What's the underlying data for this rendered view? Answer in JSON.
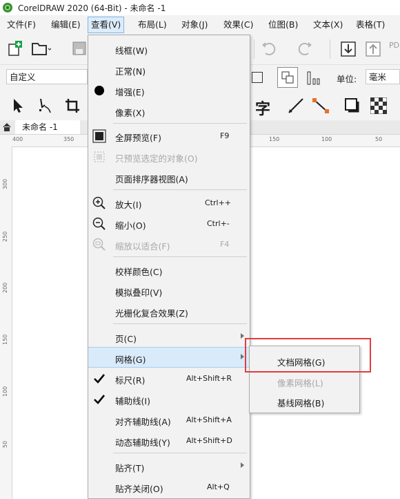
{
  "window": {
    "title": "CorelDRAW 2020 (64-Bit) - 未命名 -1"
  },
  "menubar": {
    "items": [
      {
        "label": "文件(F)"
      },
      {
        "label": "编辑(E)"
      },
      {
        "label": "查看(V)"
      },
      {
        "label": "布局(L)"
      },
      {
        "label": "对象(J)"
      },
      {
        "label": "效果(C)"
      },
      {
        "label": "位图(B)"
      },
      {
        "label": "文本(X)"
      },
      {
        "label": "表格(T)"
      }
    ]
  },
  "toolbar2": {
    "preset": "自定义",
    "units_label": "单位:",
    "units_value": "毫米"
  },
  "toolbar1": {
    "pdf_label": "PD"
  },
  "toolbar3": {
    "text_tool_glyph": "字"
  },
  "document": {
    "tab_label": "未命名 -1"
  },
  "ruler": {
    "h_labels": [
      "400",
      "350",
      "150",
      "100",
      "50"
    ],
    "v_labels": [
      "300",
      "250",
      "200",
      "150",
      "100",
      "50"
    ]
  },
  "view_menu": {
    "items": [
      {
        "label": "线框(W)",
        "shortcut": ""
      },
      {
        "label": "正常(N)",
        "shortcut": ""
      },
      {
        "label": "增强(E)",
        "shortcut": ""
      },
      {
        "label": "像素(X)",
        "shortcut": ""
      },
      {
        "label": "全屏预览(F)",
        "shortcut": "F9"
      },
      {
        "label": "只预览选定的对象(O)",
        "shortcut": ""
      },
      {
        "label": "页面排序器视图(A)",
        "shortcut": ""
      },
      {
        "label": "放大(I)",
        "shortcut": "Ctrl++"
      },
      {
        "label": "缩小(O)",
        "shortcut": "Ctrl+-"
      },
      {
        "label": "缩放以适合(F)",
        "shortcut": "F4"
      },
      {
        "label": "校样颜色(C)",
        "shortcut": ""
      },
      {
        "label": "模拟叠印(V)",
        "shortcut": ""
      },
      {
        "label": "光栅化复合效果(Z)",
        "shortcut": ""
      },
      {
        "label": "页(C)",
        "shortcut": ""
      },
      {
        "label": "网格(G)",
        "shortcut": ""
      },
      {
        "label": "标尺(R)",
        "shortcut": "Alt+Shift+R"
      },
      {
        "label": "辅助线(I)",
        "shortcut": ""
      },
      {
        "label": "对齐辅助线(A)",
        "shortcut": "Alt+Shift+A"
      },
      {
        "label": "动态辅助线(Y)",
        "shortcut": "Alt+Shift+D"
      },
      {
        "label": "贴齐(T)",
        "shortcut": ""
      },
      {
        "label": "贴齐关闭(O)",
        "shortcut": "Alt+Q"
      }
    ]
  },
  "grid_submenu": {
    "items": [
      {
        "label": "文档网格(G)"
      },
      {
        "label": "像素网格(L)"
      },
      {
        "label": "基线网格(B)"
      }
    ]
  },
  "colors": {
    "highlight_box": "#e23c3c",
    "menu_hover": "#d9ebfb",
    "check": "#1b1b1b",
    "new_badge": "#19a24a"
  }
}
